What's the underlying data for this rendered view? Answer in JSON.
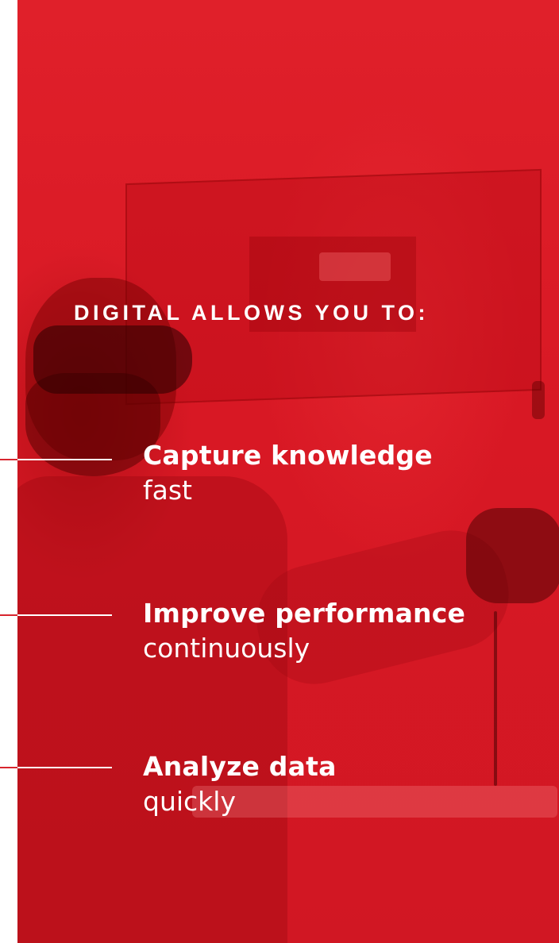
{
  "heading": "DIGITAL ALLOWS YOU TO:",
  "items": [
    {
      "bold": "Capture knowledge",
      "light": "fast"
    },
    {
      "bold": "Improve performance",
      "light": "continuously"
    },
    {
      "bold": "Analyze data",
      "light": "quickly"
    }
  ],
  "colors": {
    "panel_red": "#d81824",
    "text": "#ffffff",
    "rule": "#ffffff"
  }
}
